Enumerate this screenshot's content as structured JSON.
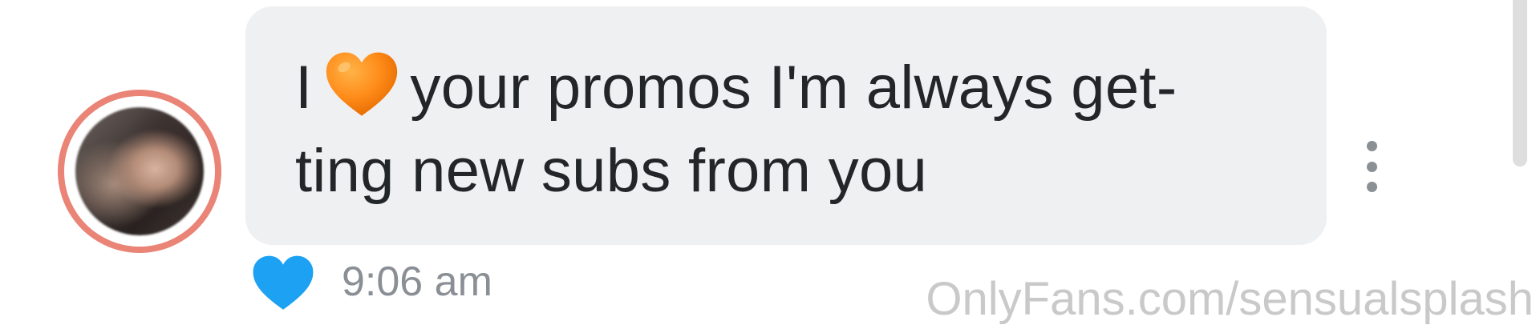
{
  "message": {
    "text_before_emoji": "I",
    "emoji": "orange-heart-icon",
    "text_line1_after_emoji": "your promos I'm always get-",
    "text_line2": "ting new subs from you",
    "timestamp": "9:06 am",
    "liked": true
  },
  "watermark": "OnlyFans.com/sensualsplash",
  "colors": {
    "bubble_bg": "#eff0f2",
    "text": "#232628",
    "timestamp": "#8a8f95",
    "like_heart": "#1da1f2",
    "emoji_heart": "#ff8c1a",
    "avatar_ring": "#e98476",
    "kebab_dots": "#8b9094",
    "watermark": "#c9c9c9"
  },
  "icons": {
    "like": "heart-icon",
    "more": "more-vertical-icon"
  }
}
